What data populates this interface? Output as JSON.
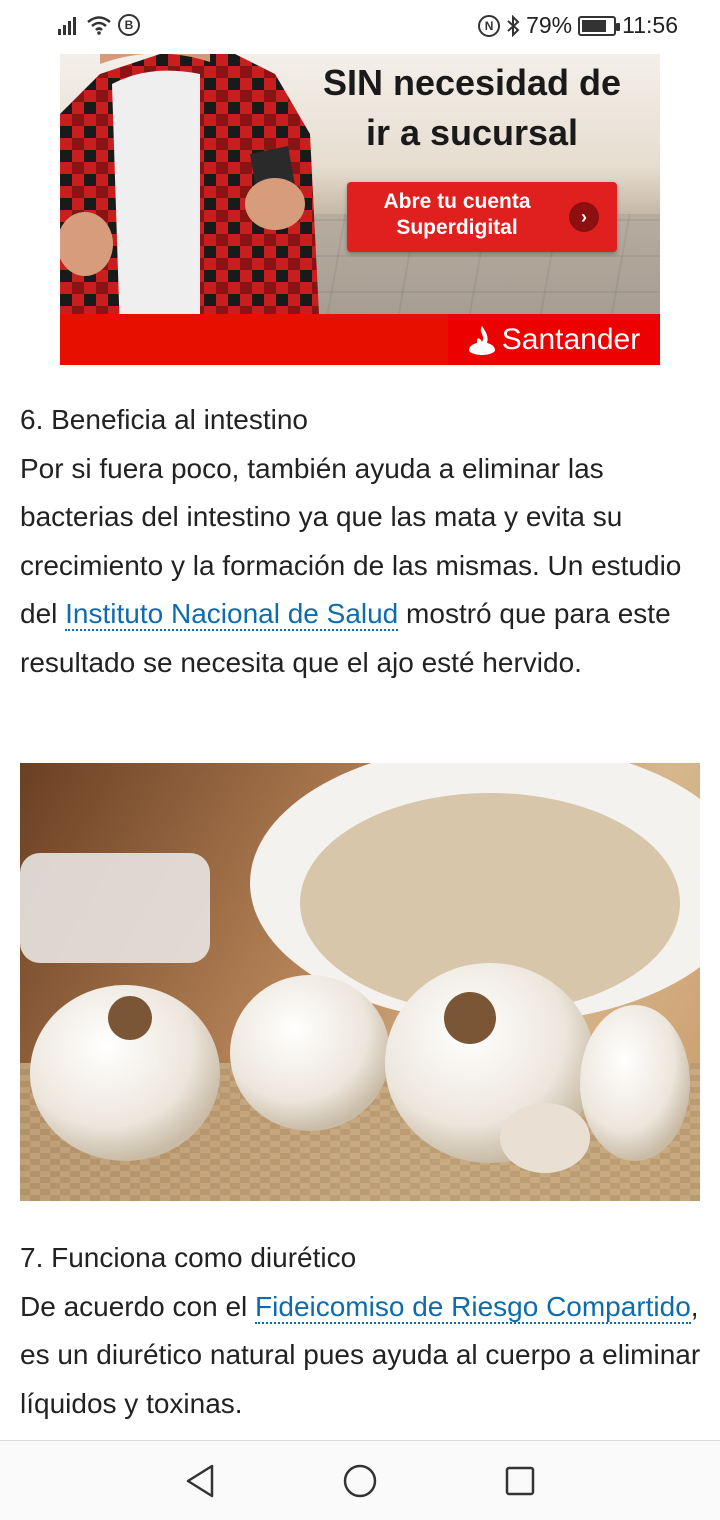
{
  "status_bar": {
    "badge_left": "B",
    "badge_right": "N",
    "battery": "79%",
    "battery_level": 0.79,
    "time": "11:56",
    "icons": [
      "signal-icon",
      "wifi-icon",
      "b-badge-icon",
      "nfc-icon",
      "bluetooth-icon",
      "battery-icon"
    ]
  },
  "ad": {
    "headline_line1": "SIN necesidad de",
    "headline_line2": "ir a sucursal",
    "cta_line1": "Abre tu cuenta",
    "cta_line2": "Superdigital",
    "brand": "Santander",
    "colors": {
      "brand_red": "#ec0000",
      "cta_red": "#e0201e"
    }
  },
  "article": {
    "section6": {
      "heading": "6. Beneficia al intestino",
      "text_before_link": "Por si fuera poco, también ayuda a eliminar las bacterias del intestino ya que las mata y evita su crecimiento y la formación de las mismas. Un estudio del ",
      "link": "Instituto Nacional de Salud",
      "text_after_link": " mostró que para este resultado se necesita que el ajo esté hervido."
    },
    "section7": {
      "heading": "7. Funciona como diurético",
      "text_before_link": "De acuerdo con el ",
      "link": "Fideicomiso de Riesgo Compartido",
      "text_after_link": ", es un diurético natural pues ayuda al cuerpo a eliminar líquidos y toxinas."
    },
    "link_color": "#0e6cad"
  },
  "nav_bar": {
    "buttons": [
      "back-icon",
      "home-icon",
      "recents-icon"
    ]
  }
}
